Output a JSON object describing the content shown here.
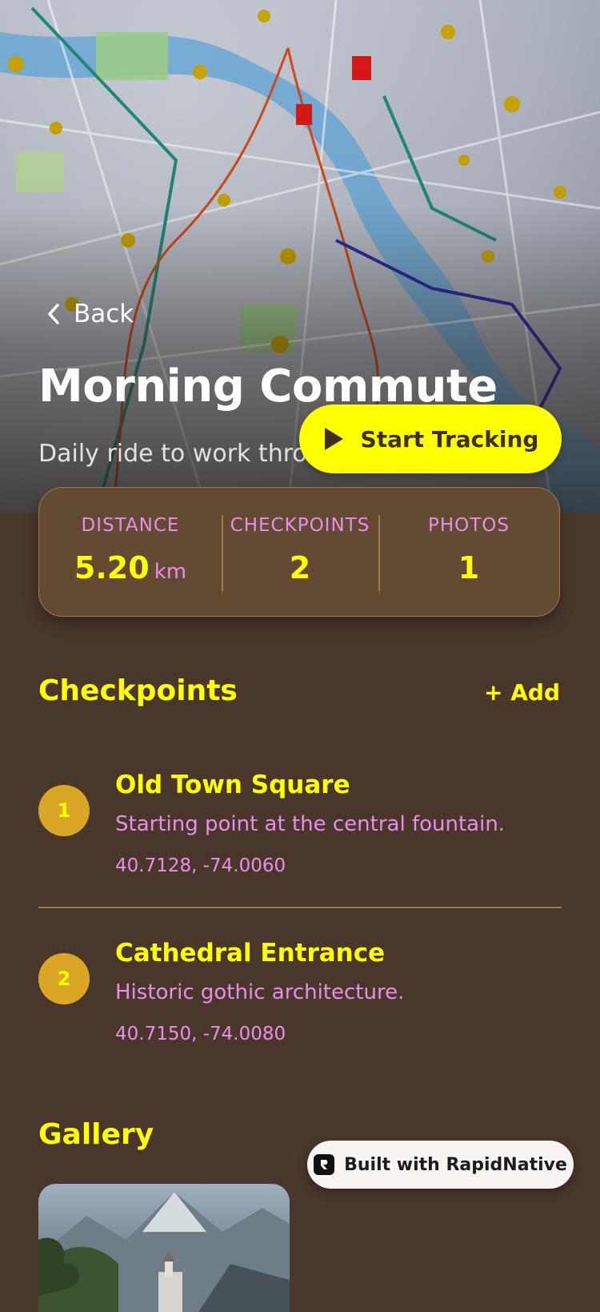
{
  "header": {
    "back_label": "Back",
    "title": "Morning Commute",
    "subtitle": "Daily ride to work through the old town",
    "start_button_label": "Start Tracking"
  },
  "stats": [
    {
      "label": "DISTANCE",
      "value": "5.20",
      "unit": "km"
    },
    {
      "label": "CHECKPOINTS",
      "value": "2"
    },
    {
      "label": "PHOTOS",
      "value": "1"
    }
  ],
  "checkpoints_section": {
    "title": "Checkpoints",
    "add_label": "+ Add",
    "items": [
      {
        "index": "1",
        "name": "Old Town Square",
        "description": "Starting point at the central fountain.",
        "coords": "40.7128, -74.0060"
      },
      {
        "index": "2",
        "name": "Cathedral Entrance",
        "description": "Historic gothic architecture.",
        "coords": "40.7150, -74.0080"
      }
    ]
  },
  "gallery": {
    "title": "Gallery"
  },
  "footer_badge": {
    "label": "Built with RapidNative"
  },
  "colors": {
    "background": "#4a372c",
    "accent_yellow": "#ffff00",
    "accent_pink": "#e88ee8",
    "badge_gold": "#d9a626",
    "card_bg": "#624a33"
  }
}
